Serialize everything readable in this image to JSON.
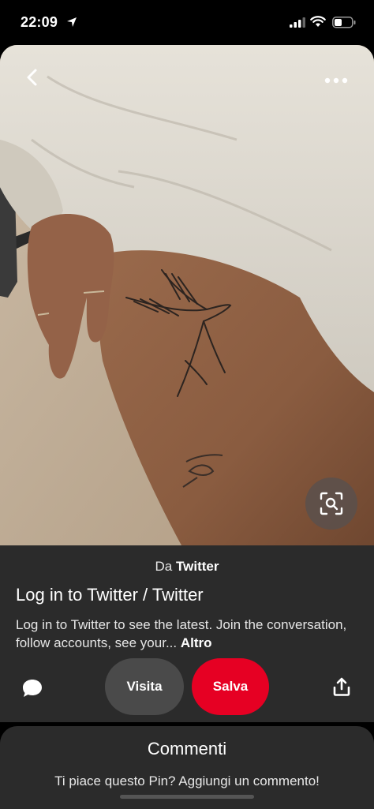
{
  "status_bar": {
    "time": "22:09"
  },
  "pin": {
    "source_prefix": "Da",
    "source_name": "Twitter",
    "title": "Log in to Twitter / Twitter",
    "description": "Log in to Twitter to see the latest. Join the conversation, follow accounts, see your...",
    "more_label": "Altro"
  },
  "actions": {
    "visit_label": "Visita",
    "save_label": "Salva"
  },
  "comments": {
    "title": "Commenti",
    "prompt": "Ti piace questo Pin? Aggiungi un commento!"
  },
  "colors": {
    "save": "#e60023",
    "panel": "#2b2b2b",
    "visit": "#4a4a4a"
  },
  "icons": [
    "location-arrow-icon",
    "signal-icon",
    "wifi-icon",
    "battery-icon",
    "back-chevron-icon",
    "more-dots-icon",
    "close-icon",
    "visual-search-icon",
    "comment-icon",
    "share-icon"
  ]
}
